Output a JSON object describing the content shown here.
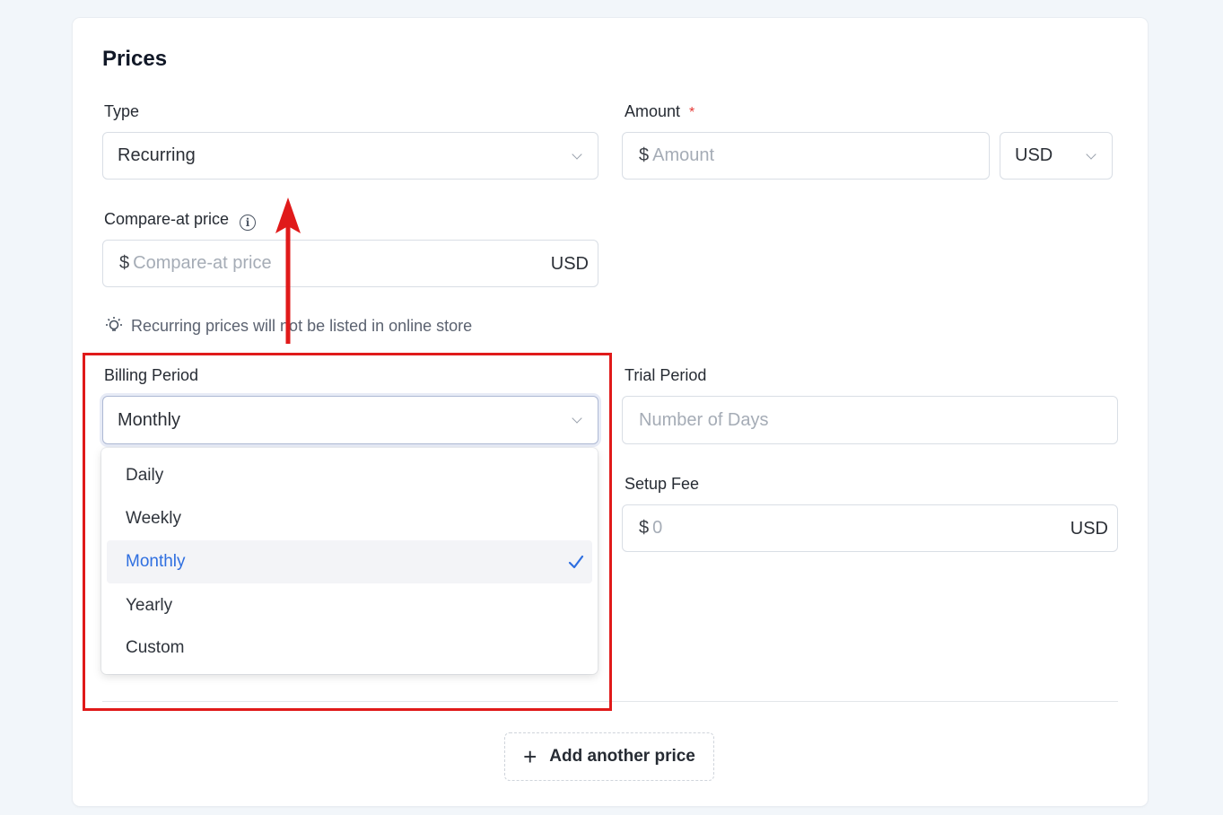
{
  "section": {
    "title": "Prices"
  },
  "type_field": {
    "label": "Type",
    "value": "Recurring"
  },
  "amount_field": {
    "label": "Amount",
    "required_mark": "*",
    "currency_symbol": "$",
    "placeholder": "Amount"
  },
  "currency_select": {
    "value": "USD"
  },
  "compare_at": {
    "label": "Compare-at price",
    "currency_symbol": "$",
    "placeholder": "Compare-at price",
    "suffix": "USD"
  },
  "hint": {
    "text": "Recurring prices will not be listed in online store"
  },
  "billing_period": {
    "label": "Billing Period",
    "value": "Monthly",
    "options": [
      {
        "label": "Daily"
      },
      {
        "label": "Weekly"
      },
      {
        "label": "Monthly"
      },
      {
        "label": "Yearly"
      },
      {
        "label": "Custom"
      }
    ]
  },
  "trial_period": {
    "label": "Trial Period",
    "placeholder": "Number of Days"
  },
  "setup_fee": {
    "label": "Setup Fee",
    "currency_symbol": "$",
    "placeholder": "0",
    "suffix": "USD"
  },
  "add_price": {
    "label": "Add another price"
  },
  "colors": {
    "accent": "#2f6fe0",
    "annotation": "#e01a1a"
  },
  "icons": {
    "info": "info-icon",
    "hint": "lightbulb-icon",
    "chevron": "chevron-down-icon",
    "check": "check-icon",
    "plus": "plus-icon"
  }
}
